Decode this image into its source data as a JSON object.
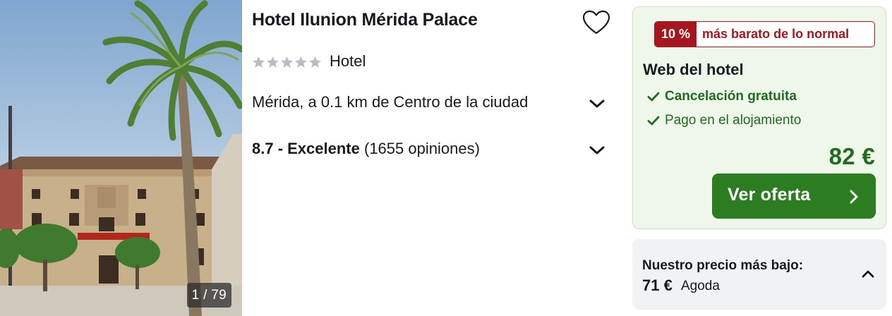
{
  "photo": {
    "counter": "1 / 79"
  },
  "hotel": {
    "name": "Hotel Ilunion Mérida Palace",
    "star_rating": 5,
    "type": "Hotel",
    "location": "Mérida, a 0.1 km de Centro de la ciudad",
    "rating_score": "8.7 - Excelente",
    "rating_reviews": "(1655 opiniones)"
  },
  "offer": {
    "deal_percent": "10 %",
    "deal_text": "más barato de lo normal",
    "provider": "Web del hotel",
    "features": [
      "Cancelación gratuita",
      "Pago en el alojamiento"
    ],
    "price": "82 €",
    "cta_label": "Ver oferta"
  },
  "lowest_price": {
    "title": "Nuestro precio más bajo:",
    "price": "71 €",
    "source": "Agoda"
  },
  "colors": {
    "deal_red": "#a5161f",
    "offer_green": "#2c7c22",
    "offer_bg": "#eef7ea",
    "panel_grey": "#f1f2f4",
    "star_grey": "#b8bcc4"
  },
  "icons": [
    "heart-icon",
    "star-icon",
    "chevron-down-icon",
    "check-icon",
    "chevron-right-icon",
    "chevron-up-icon"
  ]
}
